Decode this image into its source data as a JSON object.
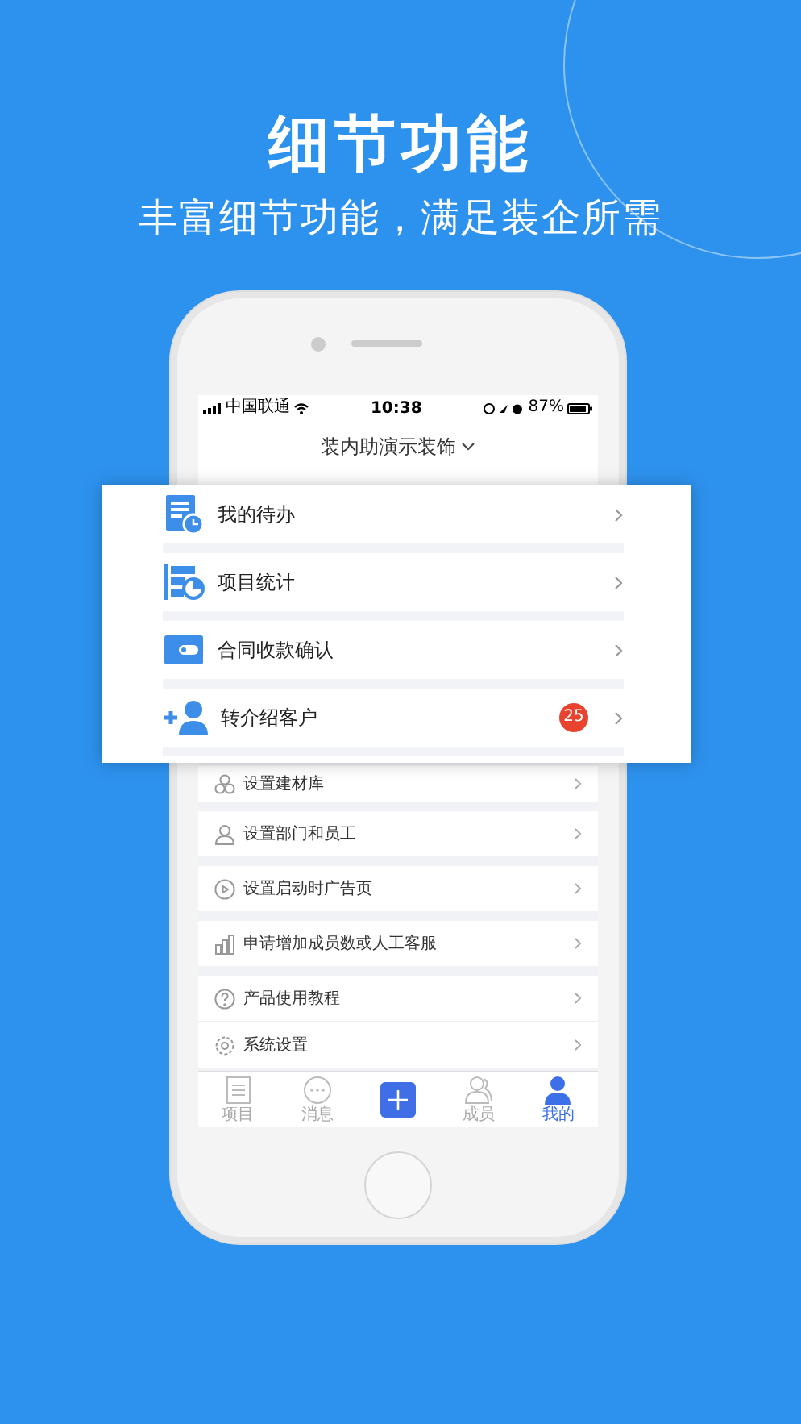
{
  "header": {
    "title": "细节功能",
    "subtitle": "丰富细节功能，满足装企所需"
  },
  "status_bar": {
    "carrier": "中国联通",
    "time": "10:38",
    "battery": "87%"
  },
  "nav_title": "装内助演示装饰",
  "featured_items": [
    {
      "label": "我的待办"
    },
    {
      "label": "项目统计"
    },
    {
      "label": "合同收款确认"
    },
    {
      "label": "转介绍客户",
      "badge": "25"
    }
  ],
  "menu_items": [
    {
      "label": "设置建材库"
    },
    {
      "label": "设置部门和员工"
    },
    {
      "label": "设置启动时广告页"
    },
    {
      "label": "申请增加成员数或人工客服"
    },
    {
      "label": "产品使用教程"
    },
    {
      "label": "系统设置"
    }
  ],
  "tab_bar": [
    {
      "label": "项目",
      "selected": false,
      "kind": "tab"
    },
    {
      "label": "消息",
      "selected": false,
      "kind": "tab"
    },
    {
      "kind": "add"
    },
    {
      "label": "成员",
      "selected": false,
      "kind": "tab"
    },
    {
      "label": "我的",
      "selected": true,
      "kind": "tab"
    }
  ]
}
